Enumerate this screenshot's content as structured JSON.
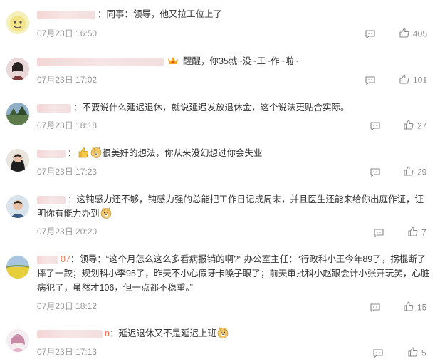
{
  "comments": [
    {
      "user": "",
      "colon": "：",
      "text": "同事：领导，他又拉工位上了",
      "time": "07月23日 16:50",
      "likes": "405"
    },
    {
      "user": "",
      "colon": "：",
      "text": "醒醒，你35就~没~工~作~啦~",
      "time": "07月23日 17:02",
      "likes": "101"
    },
    {
      "user": "",
      "colon": "：",
      "text": "不要说什么延迟退休，就说延迟发放退休金，这个说法更贴合实际。",
      "time": "07月23日 18:18",
      "likes": "27"
    },
    {
      "user": "",
      "colon": "：",
      "text": "很美好的想法，你从来没幻想过你会失业",
      "time": "07月23日 17:23",
      "likes": "29"
    },
    {
      "user": "",
      "colon": "：",
      "text": "这钝感力还不够，钝感力强的总能把工作日记成周末，并且医生还能来给你出庭作证，证明你有能力办到",
      "time": "07月23日 20:20",
      "likes": "7"
    },
    {
      "user": "07",
      "colon": "：",
      "text": "领导：“这个月怎么这么多看病报销的啊?”  办公室主任：“行政科小王今年89了，拐棍断了摔了一跤；规划科小李95了，昨天不小心假牙卡嗓子眼了；前天审批科小赵跟会计小张开玩笑，心脏病犯了，虽然才106，但一点都不稳重。”",
      "time": "07月23日 18:12",
      "likes": "15"
    },
    {
      "user": "n",
      "colon": "：",
      "text": "延迟退休又不是延迟上班",
      "time": "07月23日 17:13",
      "likes": "5"
    }
  ],
  "icons": {
    "reply": "comment-icon",
    "like": "thumbs-up-icon"
  },
  "colors": {
    "username": "#eb7350",
    "meta": "#999999",
    "text": "#333333"
  }
}
